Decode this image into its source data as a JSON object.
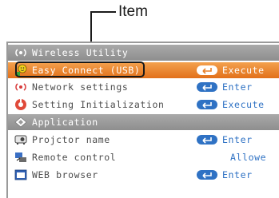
{
  "callout": {
    "label": "Item"
  },
  "menu": {
    "sections": {
      "wireless": "Wireless Utility",
      "application": "Application"
    },
    "items": [
      {
        "label": "Easy Connect (USB)",
        "action": "Execute",
        "icon": "easy-connect-icon",
        "selected": true
      },
      {
        "label": "Network settings",
        "action": "Enter",
        "icon": "network-icon"
      },
      {
        "label": "Setting Initialization",
        "action": "Execute",
        "icon": "initialization-icon"
      },
      {
        "label": "Projctor name",
        "action": "Enter",
        "icon": "projector-name-icon"
      },
      {
        "label": "Remote control",
        "action": "Allowe",
        "icon": "remote-control-icon"
      },
      {
        "label": "WEB browser",
        "action": "Enter",
        "icon": "web-browser-icon"
      }
    ]
  },
  "colors": {
    "selected_row": "#e8812a",
    "section_header": "#9a9a9a",
    "action_blue": "#2f72c4"
  }
}
